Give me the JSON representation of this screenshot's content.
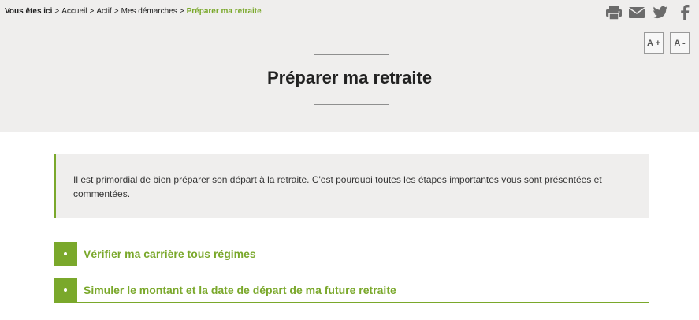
{
  "breadcrumb": {
    "lead": "Vous êtes ici",
    "separator": ">",
    "items": [
      "Accueil",
      "Actif",
      "Mes démarches"
    ],
    "current": "Préparer ma retraite"
  },
  "share": {
    "icons": [
      "print-icon",
      "envelope-icon",
      "twitter-icon",
      "facebook-icon"
    ],
    "icon_color": "#6b6b6b"
  },
  "font_size": {
    "increase_label": "A +",
    "decrease_label": "A -"
  },
  "page": {
    "title": "Préparer ma retraite"
  },
  "intro": {
    "text": "Il est primordial de bien préparer son départ à la retraite. C'est pourquoi toutes les étapes importantes vous sont présentées et commentées."
  },
  "accordion": {
    "items": [
      {
        "label": "Vérifier ma carrière tous régimes"
      },
      {
        "label": "Simuler le montant et la date de départ de ma future retraite"
      }
    ]
  },
  "colors": {
    "accent": "#7aa82b",
    "band": "#efeeed",
    "text": "#222222"
  }
}
